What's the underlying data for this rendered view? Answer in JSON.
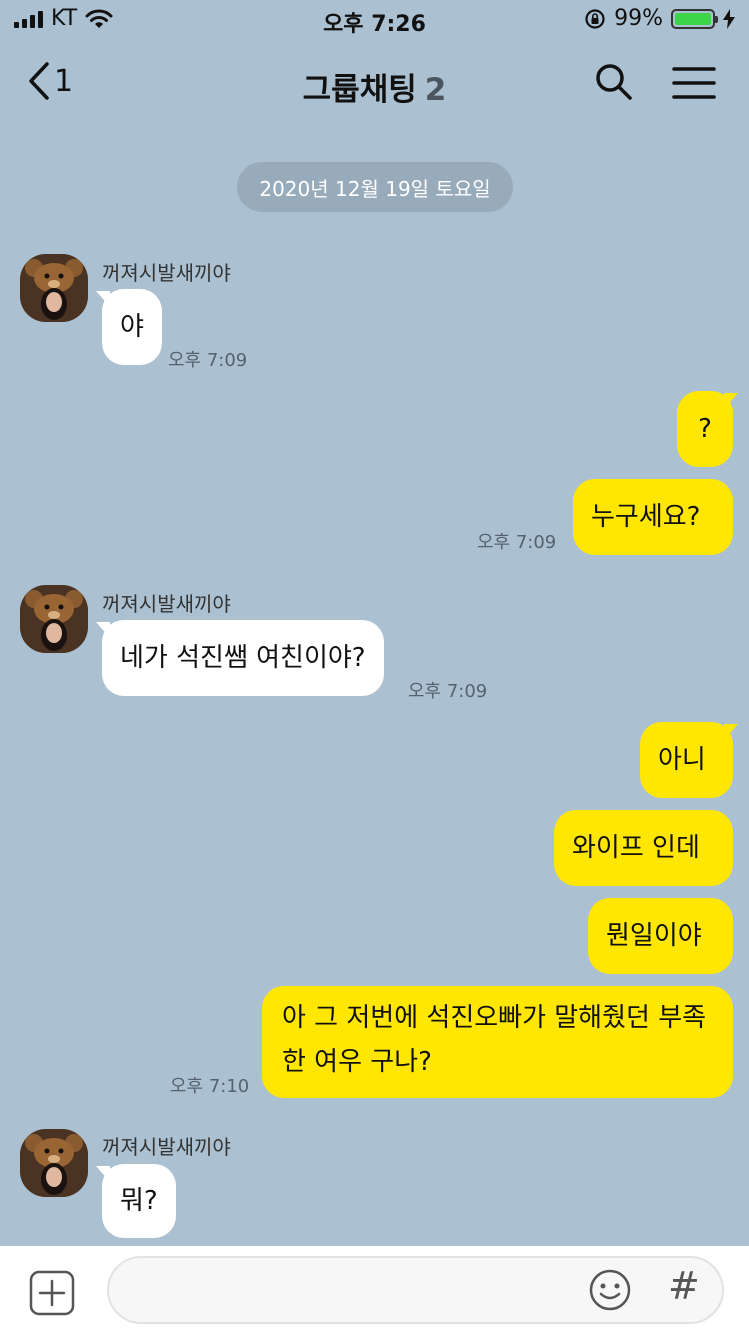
{
  "status_bar": {
    "carrier": "KT",
    "time": "오후 7:26",
    "battery_percent": "99%",
    "battery_level": 0.99
  },
  "header": {
    "back_count": "1",
    "title": "그룹채팅",
    "member_count": "2"
  },
  "date_divider": "2020년 12월 19일 토요일",
  "messages": [
    {
      "direction": "in",
      "sender": "꺼져시발새끼야",
      "text": "야",
      "time": "오후 7:09"
    },
    {
      "direction": "out",
      "text": "?"
    },
    {
      "direction": "out",
      "text": "누구세요?",
      "time": "오후 7:09"
    },
    {
      "direction": "in",
      "sender": "꺼져시발새끼야",
      "text": "네가 석진쌤 여친이야?",
      "time": "오후 7:09"
    },
    {
      "direction": "out",
      "text": "아니"
    },
    {
      "direction": "out",
      "text": "와이프 인데"
    },
    {
      "direction": "out",
      "text": "뭔일이야"
    },
    {
      "direction": "out",
      "text": "아 그 저번에 석진오빠가 말해줬던 부족한 여우 구나?",
      "time": "오후 7:10"
    },
    {
      "direction": "in",
      "sender": "꺼져시발새끼야",
      "text": "뭐?"
    }
  ],
  "input": {
    "placeholder": ""
  },
  "colors": {
    "background": "#abc1d1",
    "outgoing_bubble": "#ffe603",
    "incoming_bubble": "#ffffff",
    "battery_fill": "#3cd54a"
  }
}
